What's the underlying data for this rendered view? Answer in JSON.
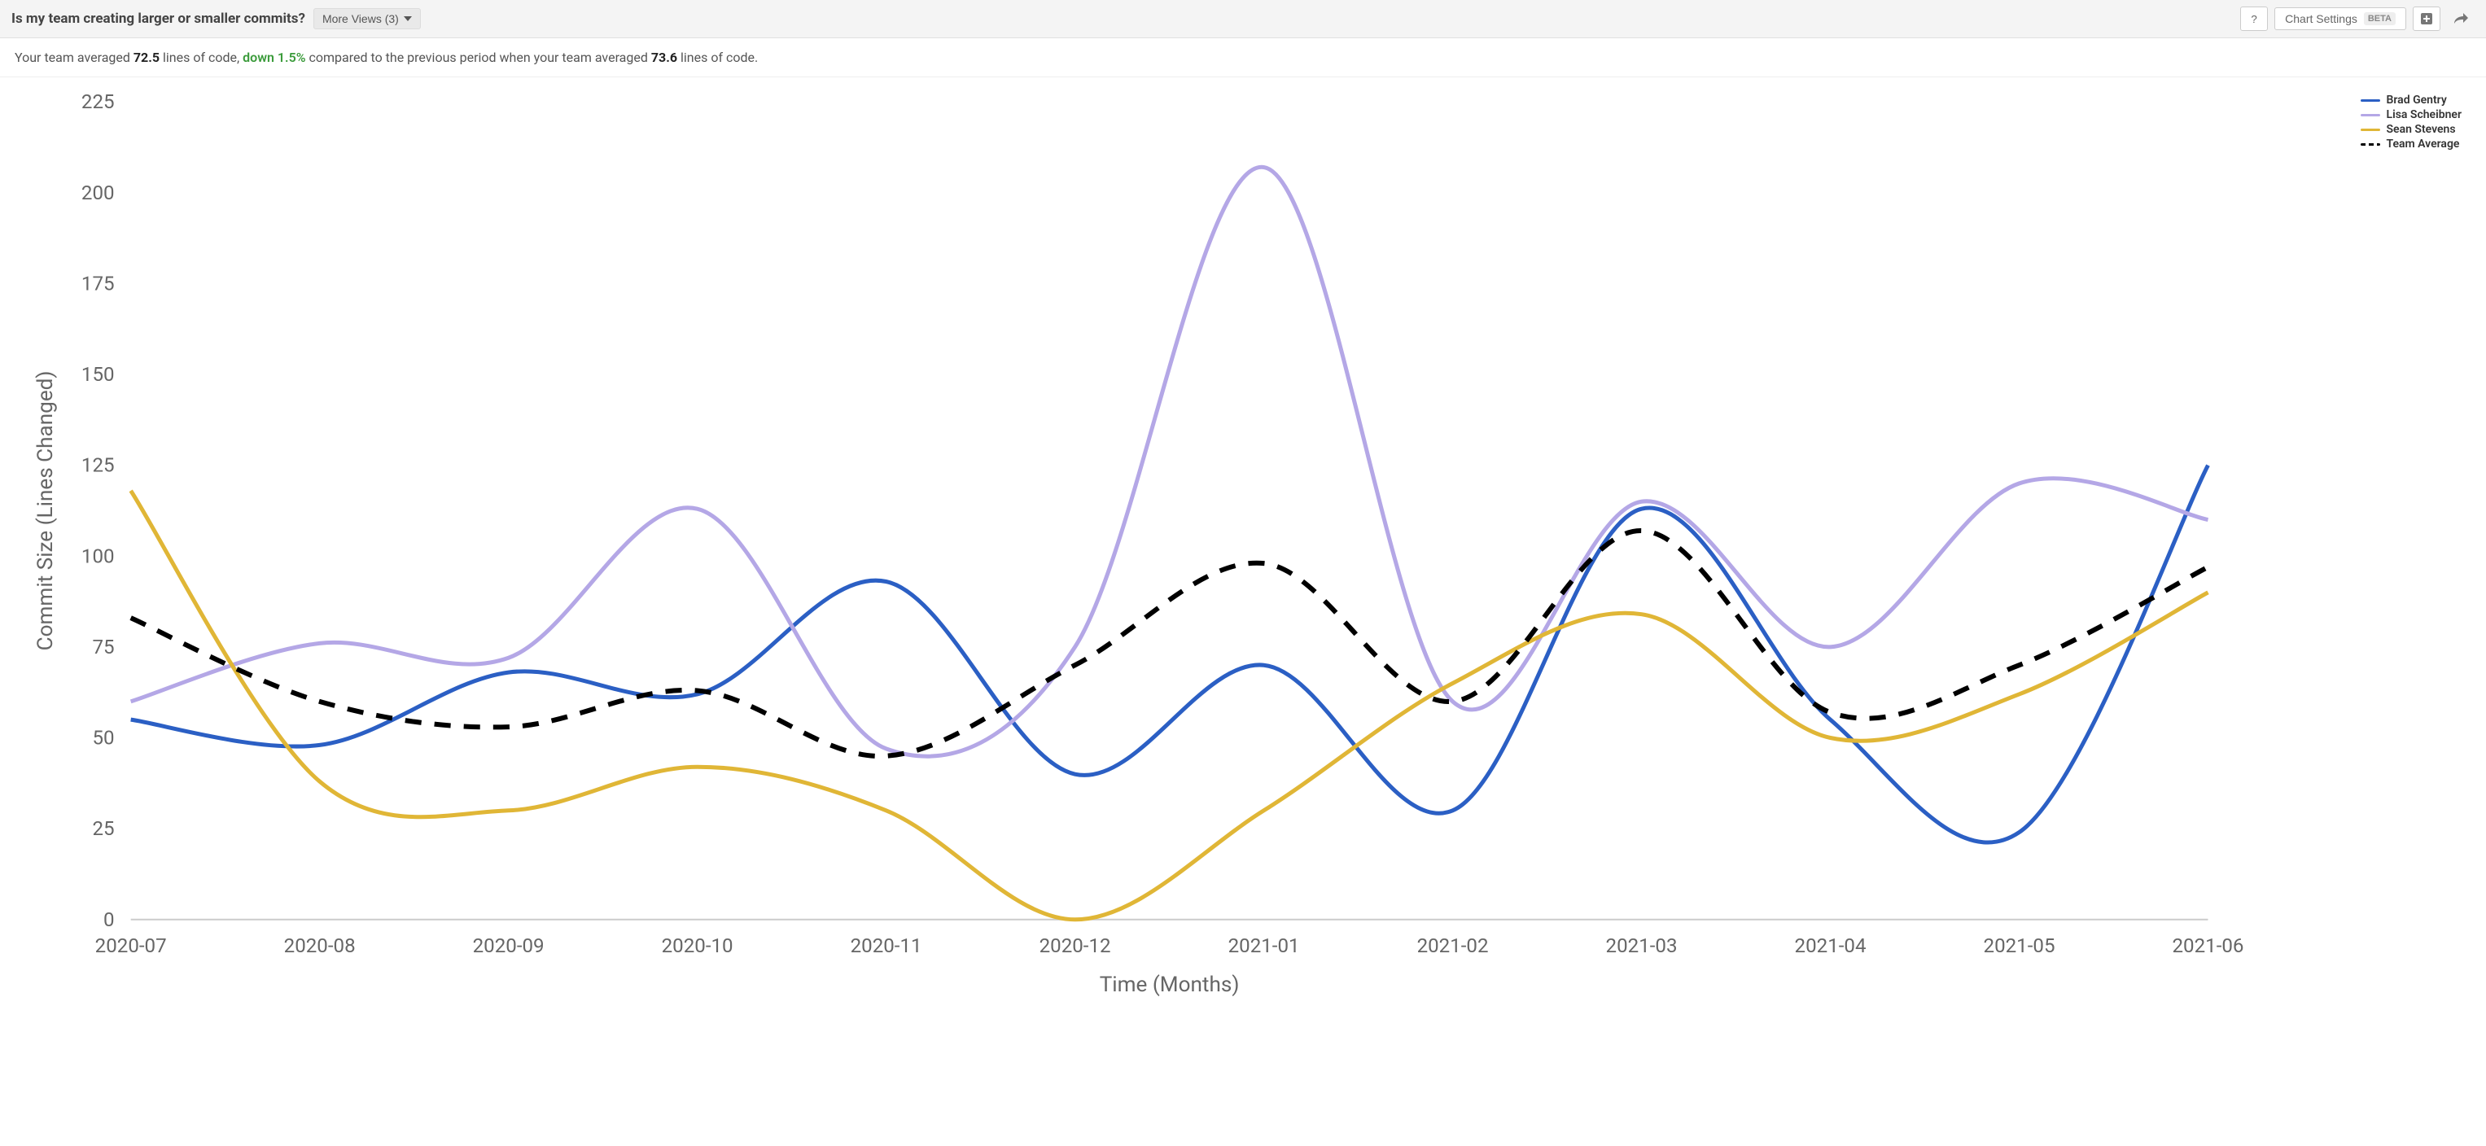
{
  "header": {
    "title": "Is my team creating larger or smaller commits?",
    "more_views_label": "More Views (3)",
    "help_tooltip": "?",
    "chart_settings_label": "Chart Settings",
    "beta_badge": "BETA"
  },
  "summary": {
    "prefix": "Your team averaged ",
    "avg_value": "72.5",
    "mid1": " lines of code, ",
    "delta": "down 1.5%",
    "mid2": " compared to the previous period when your team averaged ",
    "prev_avg": "73.6",
    "suffix": " lines of code."
  },
  "legend": [
    {
      "name": "Brad Gentry",
      "color": "#2b5fc4",
      "style": "solid"
    },
    {
      "name": "Lisa Scheibner",
      "color": "#b4a7e6",
      "style": "solid"
    },
    {
      "name": "Sean Stevens",
      "color": "#e0b636",
      "style": "solid"
    },
    {
      "name": "Team Average",
      "color": "#000000",
      "style": "dashed"
    }
  ],
  "chart_data": {
    "type": "line",
    "title": "Is my team creating larger or smaller commits?",
    "xlabel": "Time (Months)",
    "ylabel": "Commit Size (Lines Changed)",
    "ylim": [
      0,
      225
    ],
    "y_ticks": [
      0,
      25,
      50,
      75,
      100,
      125,
      150,
      175,
      200,
      225
    ],
    "categories": [
      "2020-07",
      "2020-08",
      "2020-09",
      "2020-10",
      "2020-11",
      "2020-12",
      "2021-01",
      "2021-02",
      "2021-03",
      "2021-04",
      "2021-05",
      "2021-06"
    ],
    "series": [
      {
        "name": "Brad Gentry",
        "color": "#2b5fc4",
        "values": [
          55,
          48,
          68,
          62,
          93,
          40,
          70,
          30,
          113,
          55,
          24,
          125
        ]
      },
      {
        "name": "Lisa Scheibner",
        "color": "#b4a7e6",
        "values": [
          60,
          76,
          72,
          113,
          47,
          75,
          207,
          60,
          115,
          75,
          120,
          110
        ]
      },
      {
        "name": "Sean Stevens",
        "color": "#e0b636",
        "values": [
          118,
          38,
          30,
          42,
          30,
          0,
          30,
          65,
          84,
          50,
          62,
          90
        ]
      },
      {
        "name": "Team Average",
        "color": "#000000",
        "style": "dashed",
        "values": [
          83,
          60,
          53,
          63,
          45,
          70,
          98,
          60,
          107,
          57,
          70,
          97
        ]
      }
    ]
  }
}
